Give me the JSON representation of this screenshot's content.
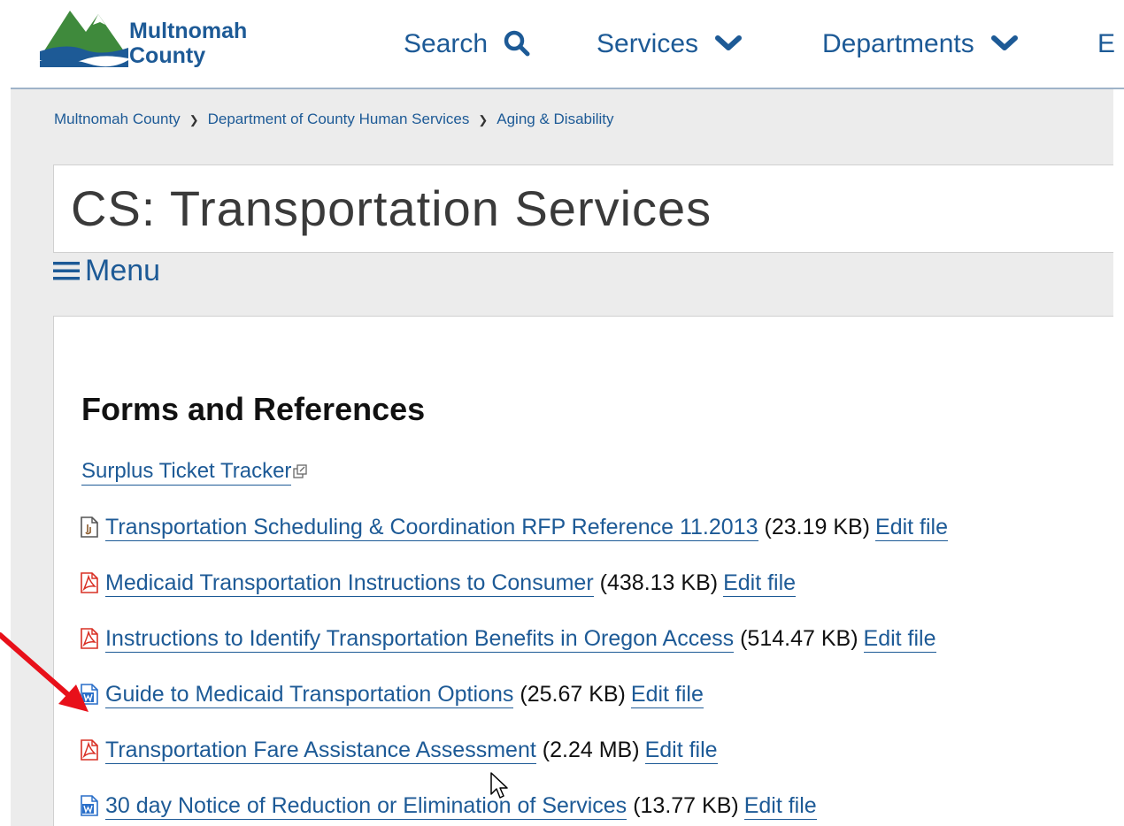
{
  "header": {
    "logo_line1": "Multnomah",
    "logo_line2": "County",
    "nav": [
      {
        "label": "Search",
        "icon": "search-icon"
      },
      {
        "label": "Services",
        "icon": "chevron-down-icon"
      },
      {
        "label": "Departments",
        "icon": "chevron-down-icon"
      },
      {
        "label": "E"
      }
    ]
  },
  "breadcrumb": [
    "Multnomah County",
    "Department of County Human Services",
    "Aging & Disability"
  ],
  "page_title": "CS: Transportation Services",
  "menu_label": "Menu",
  "section_heading": "Forms and References",
  "links": [
    {
      "title": "Surplus Ticket Tracker",
      "type": "external"
    },
    {
      "title": "Transportation Scheduling & Coordination RFP Reference 11.2013",
      "size": "(23.19 KB)",
      "edit": "Edit file",
      "type": "generic"
    },
    {
      "title": "Medicaid Transportation Instructions to Consumer",
      "size": "(438.13 KB)",
      "edit": "Edit file",
      "type": "pdf"
    },
    {
      "title": "Instructions to Identify Transportation Benefits in Oregon Access",
      "size": "(514.47 KB)",
      "edit": "Edit file",
      "type": "pdf"
    },
    {
      "title": "Guide to Medicaid Transportation Options",
      "size": "(25.67 KB)",
      "edit": "Edit file",
      "type": "word"
    },
    {
      "title": "Transportation Fare Assistance Assessment",
      "size": "(2.24 MB)",
      "edit": "Edit file",
      "type": "pdf"
    },
    {
      "title": "30 day Notice of Reduction or Elimination of Services",
      "size": "(13.77 KB)",
      "edit": "Edit file",
      "type": "word"
    }
  ],
  "colors": {
    "link": "#1d5a96",
    "logo_green": "#3f8a3c",
    "pdf_red": "#d93025",
    "word_blue": "#2a6fc9",
    "annotation_arrow": "#e8101a"
  }
}
